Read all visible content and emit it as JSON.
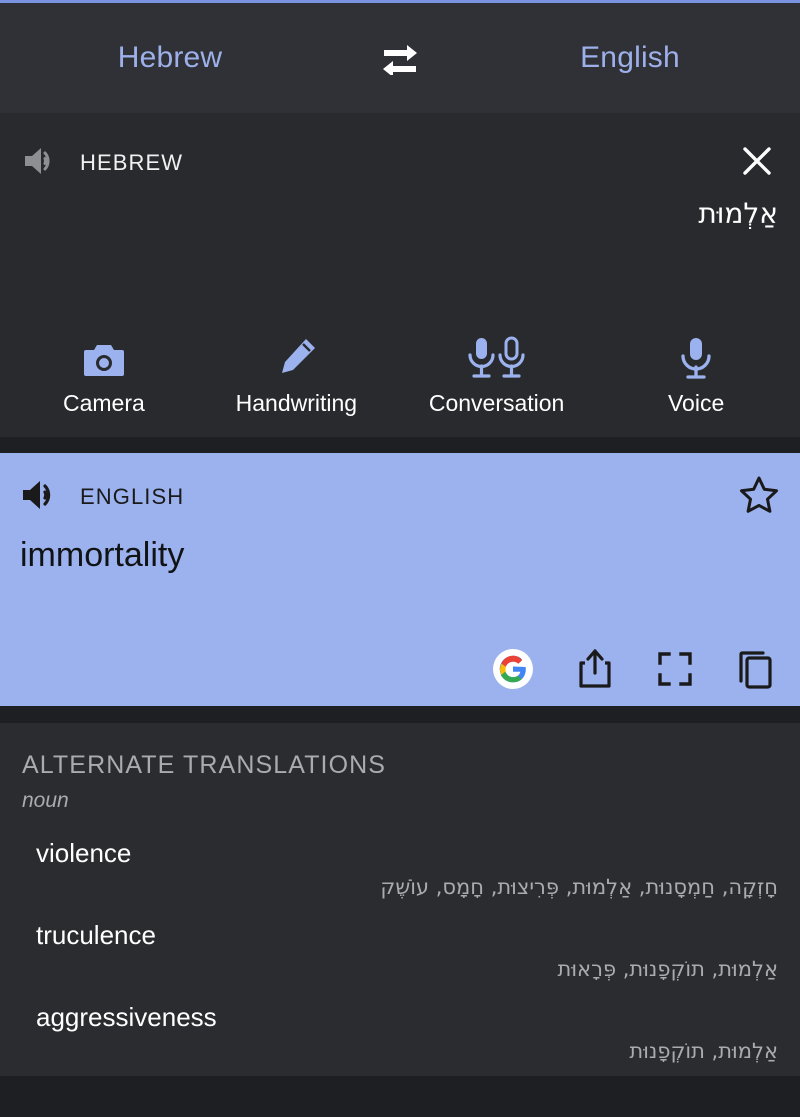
{
  "theme": {
    "accent_line": "#7a93e0",
    "header_bg": "#303136",
    "source_bg": "#282a2e",
    "card_bg": "#9cb2ee",
    "alt_panel_bg": "#2b2c30",
    "page_bg": "#1e1f22",
    "lang_link": "#9db0ea",
    "muted_text": "#a9abaf"
  },
  "header": {
    "source_language": "Hebrew",
    "target_language": "English",
    "swap_icon": "swap-horizontal-icon"
  },
  "source": {
    "speaker_icon": "speaker-icon",
    "language_label": "HEBREW",
    "close_icon": "close-icon",
    "text": "אַלְמוּת"
  },
  "input_methods": [
    {
      "label": "Camera",
      "icon": "camera-icon"
    },
    {
      "label": "Handwriting",
      "icon": "pen-icon"
    },
    {
      "label": "Conversation",
      "icon": "two-microphones-icon"
    },
    {
      "label": "Voice",
      "icon": "microphone-icon"
    }
  ],
  "translation_card": {
    "speaker_icon": "speaker-icon",
    "language_label": "ENGLISH",
    "star_icon": "star-outline-icon",
    "text": "immortality",
    "actions": [
      {
        "name": "google-search-icon",
        "label": "G"
      },
      {
        "name": "share-icon",
        "label": ""
      },
      {
        "name": "fullscreen-icon",
        "label": ""
      },
      {
        "name": "copy-icon",
        "label": ""
      }
    ]
  },
  "alternates": {
    "title": "ALTERNATE TRANSLATIONS",
    "part_of_speech": "noun",
    "items": [
      {
        "word": "violence",
        "hebrew": "חָזְקָה, חַמְסָנוּת, אַלְמוּת, פְּרִיצוּת, חָמָס, עוֹשֶׁק"
      },
      {
        "word": "truculence",
        "hebrew": "אַלְמוּת, תוֹקְפָנוּת, פְּרָאוּת"
      },
      {
        "word": "aggressiveness",
        "hebrew": "אַלְמוּת, תוֹקְפָנוּת"
      }
    ]
  }
}
